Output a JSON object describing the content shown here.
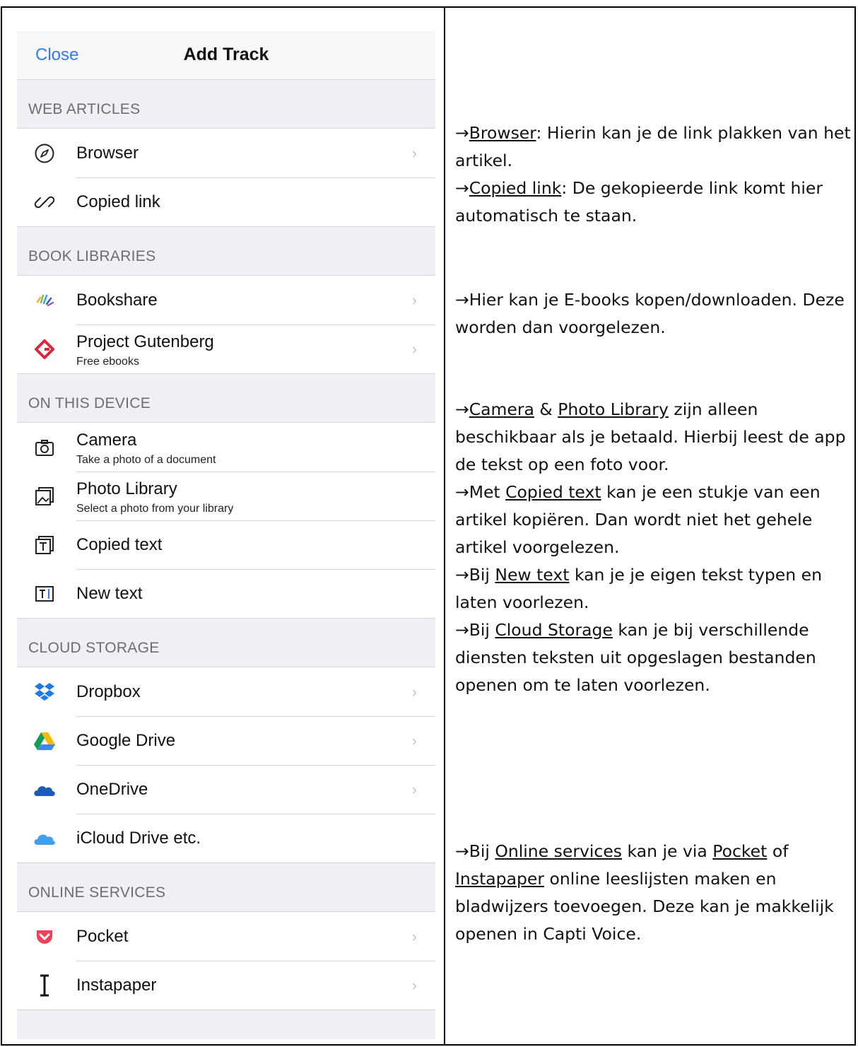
{
  "navbar": {
    "close_label": "Close",
    "title": "Add Track"
  },
  "sections": {
    "web": {
      "header": "WEB ARTICLES",
      "browser": "Browser",
      "copied_link": "Copied link"
    },
    "books": {
      "header": "BOOK LIBRARIES",
      "bookshare": "Bookshare",
      "gutenberg": "Project Gutenberg",
      "gutenberg_sub": "Free ebooks"
    },
    "device": {
      "header": "ON THIS DEVICE",
      "camera": "Camera",
      "camera_sub": "Take a photo of a document",
      "photo_library": "Photo Library",
      "photo_library_sub": "Select a photo from your library",
      "copied_text": "Copied text",
      "new_text": "New text"
    },
    "cloud": {
      "header": "CLOUD STORAGE",
      "dropbox": "Dropbox",
      "gdrive": "Google Drive",
      "onedrive": "OneDrive",
      "icloud": "iCloud Drive etc."
    },
    "online": {
      "header": "ONLINE SERVICES",
      "pocket": "Pocket",
      "instapaper": "Instapaper"
    }
  },
  "notes": {
    "arrow": "→",
    "n1": {
      "link": "Browser",
      "text": ": Hierin kan je de link plakken van het artikel."
    },
    "n2": {
      "link": "Copied link",
      "text": ": De gekopieerde link komt hier automatisch te staan."
    },
    "n3": {
      "text": "Hier kan je E-books kopen/downloaden. Deze worden dan voorgelezen."
    },
    "n4": {
      "link1": "Camera",
      "amp": " & ",
      "link2": "Photo Library",
      "text": " zijn alleen beschikbaar als je betaald. Hierbij leest de app de tekst op een foto voor."
    },
    "n5": {
      "pre": "Met ",
      "link": "Copied text",
      "text": " kan je een stukje van een artikel kopiëren. Dan wordt niet het gehele artikel voorgelezen."
    },
    "n6": {
      "pre": "Bij ",
      "link": "New text",
      "text": " kan je je eigen tekst typen en laten voorlezen."
    },
    "n7": {
      "pre": "Bij ",
      "link": "Cloud Storage",
      "text": " kan je bij verschillende diensten teksten uit opgeslagen bestanden openen om te laten voorlezen."
    },
    "n8": {
      "pre": "Bij ",
      "link1": "Online services",
      "mid1": " kan je via ",
      "link2": "Pocket",
      "mid2": " of ",
      "link3": "Instapaper",
      "text": " online leeslijsten maken en bladwijzers toevoegen. Deze kan je makkelijk openen in Capti Voice."
    }
  },
  "colors": {
    "ios_blue": "#2f7cf6",
    "gutenberg_red": "#e0243a",
    "dropbox_blue": "#1f7ae8",
    "onedrive_blue": "#1b5cb8",
    "icloud_blue": "#3f9ff0",
    "pocket_red": "#ee4056"
  }
}
